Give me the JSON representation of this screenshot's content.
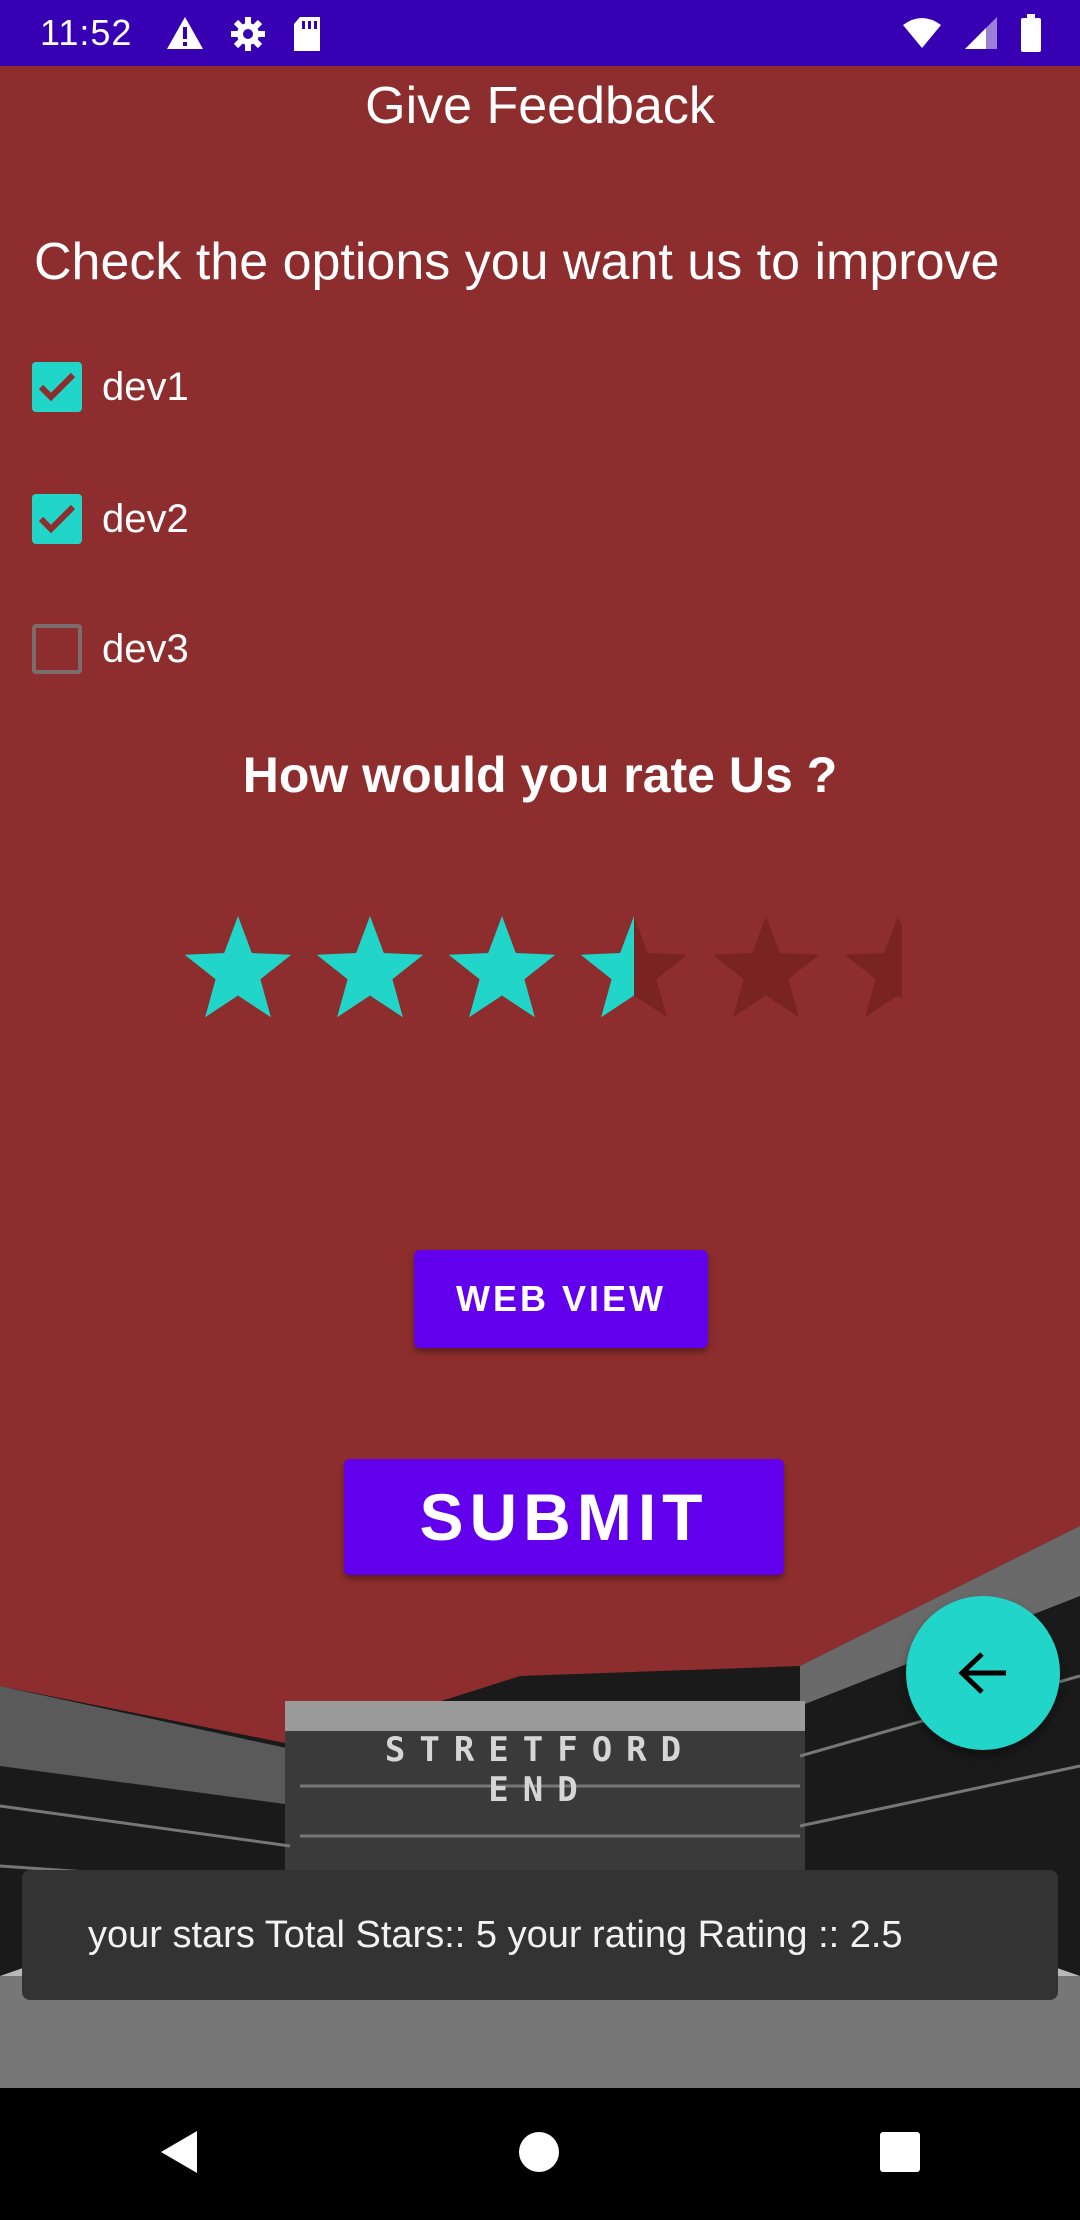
{
  "status_bar": {
    "time": "11:52",
    "icons_left": [
      "warning-icon",
      "gear-icon",
      "sd-card-icon"
    ],
    "icons_right": [
      "wifi-icon",
      "signal-icon",
      "battery-icon"
    ],
    "background": "#3700b3"
  },
  "header": {
    "title": "Give Feedback"
  },
  "feedback": {
    "prompt": "Check the options you want us to improve",
    "options": [
      {
        "label": "dev1",
        "checked": true
      },
      {
        "label": "dev2",
        "checked": true
      },
      {
        "label": "dev3",
        "checked": false
      }
    ]
  },
  "rating": {
    "question": "How would you rate Us ?",
    "filled_stars": 3.5,
    "star_color": "#21d6c8",
    "empty_star_color": "#7a2323"
  },
  "buttons": {
    "web_view": "WEB VIEW",
    "submit": "SUBMIT"
  },
  "stadium": {
    "line1": "STRETFORD",
    "line2": "END"
  },
  "fab": {
    "icon": "arrow-back-icon",
    "color": "#21d6c8"
  },
  "toast": {
    "message": "your stars Total Stars:: 5 your rating Rating :: 2.5"
  },
  "nav": {
    "icons": [
      "back-triangle-icon",
      "home-circle-icon",
      "recents-square-icon"
    ]
  },
  "colors": {
    "background": "#8d2d2d",
    "accent": "#6200ee",
    "teal": "#21d6c8"
  }
}
